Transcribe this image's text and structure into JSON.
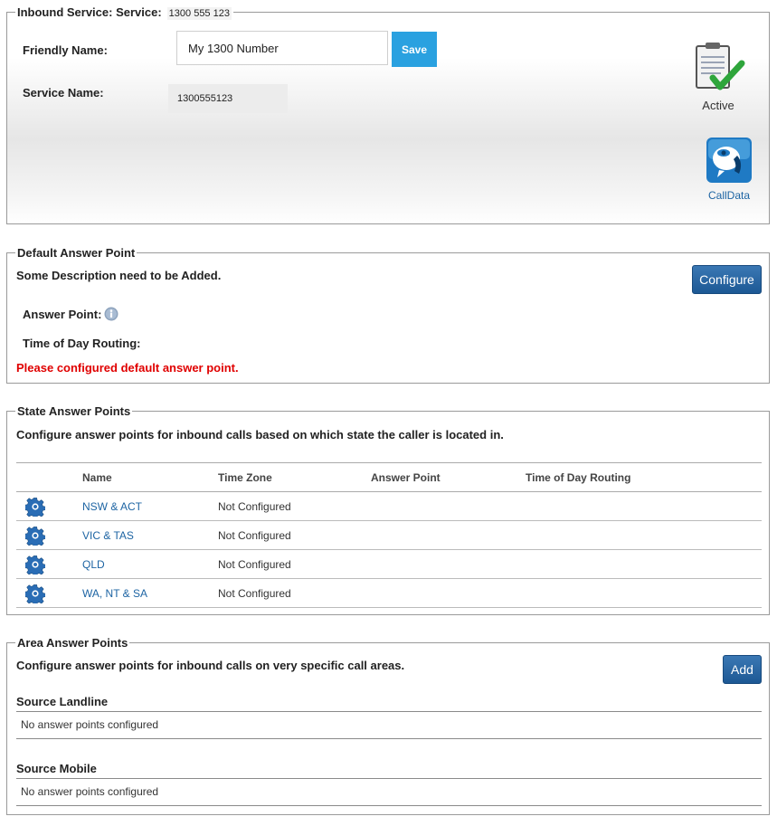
{
  "inbound_service": {
    "legend": "Inbound Service: Service:",
    "number": "1300 555 123",
    "friendly_name_label": "Friendly Name:",
    "friendly_name_value": "My 1300 Number",
    "save_label": "Save",
    "service_name_label": "Service Name:",
    "service_name_value": "1300555123",
    "status_label": "Active",
    "calldata_label": "CallData"
  },
  "default_answer_point": {
    "legend": "Default Answer Point",
    "description": "Some Description need to be Added.",
    "configure_label": "Configure",
    "answer_point_label": "Answer Point:",
    "tod_label": "Time of Day Routing:",
    "error": "Please configured default answer point."
  },
  "state_answer_points": {
    "legend": "State Answer Points",
    "description": "Configure answer points for inbound calls based on which state the caller is located in.",
    "columns": [
      "Name",
      "Time Zone",
      "Answer Point",
      "Time of Day Routing"
    ],
    "rows": [
      {
        "name": "NSW & ACT",
        "time_zone": "Not Configured",
        "answer_point": "",
        "tod": ""
      },
      {
        "name": "VIC & TAS",
        "time_zone": "Not Configured",
        "answer_point": "",
        "tod": ""
      },
      {
        "name": "QLD",
        "time_zone": "Not Configured",
        "answer_point": "",
        "tod": ""
      },
      {
        "name": "WA, NT & SA",
        "time_zone": "Not Configured",
        "answer_point": "",
        "tod": ""
      }
    ]
  },
  "area_answer_points": {
    "legend": "Area Answer Points",
    "description": "Configure answer points for inbound calls on very specific call areas.",
    "add_label": "Add",
    "landline_head": "Source Landline",
    "landline_empty": "No answer points configured",
    "mobile_head": "Source Mobile",
    "mobile_empty": "No answer points configured"
  },
  "colors": {
    "link": "#1d64a3",
    "save_button": "#2aa1e0",
    "dark_button": "#1d5894",
    "error": "#e00000"
  }
}
